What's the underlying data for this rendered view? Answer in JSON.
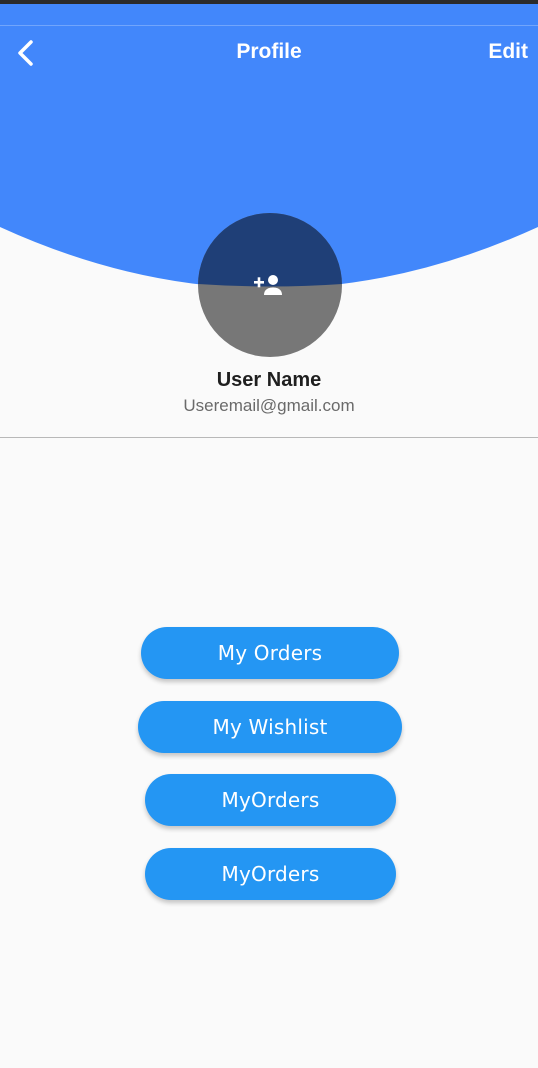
{
  "app_bar": {
    "title": "Profile",
    "edit_label": "Edit",
    "back_icon": "chevron-left-icon"
  },
  "profile": {
    "avatar_icon": "add-person-icon",
    "name": "User Name",
    "email": "Useremail@gmail.com"
  },
  "menu": {
    "items": [
      {
        "label": "My Orders"
      },
      {
        "label": "My Wishlist"
      },
      {
        "label": "MyOrders"
      },
      {
        "label": "MyOrders"
      }
    ]
  },
  "colors": {
    "header_blue": "#4287fb",
    "button_blue": "#2496f3",
    "avatar_gray": "#777777",
    "avatar_overlay": "#1f3f77",
    "background": "#fafafa"
  }
}
